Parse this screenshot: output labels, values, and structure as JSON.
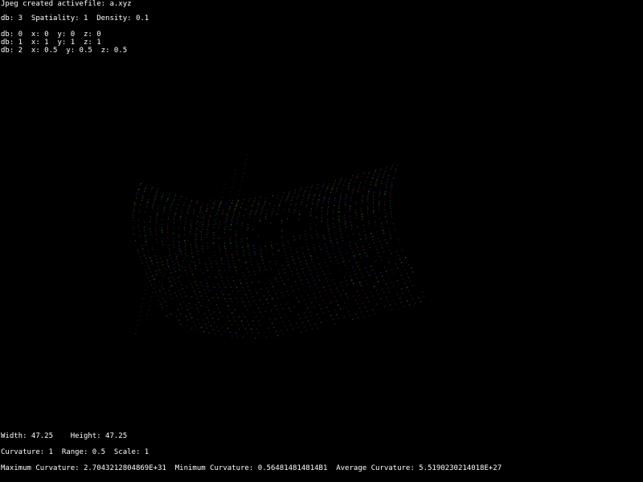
{
  "status": {
    "text": "Jpeg created activefile: a.xyz"
  },
  "db_summary": {
    "text": "db: 3  Spatiality: 1  Density: 0.1"
  },
  "databases": [
    {
      "text": "db: 0  x: 0  y: 0  z: 0"
    },
    {
      "text": "db: 1  x: 1  y: 1  z: 1"
    },
    {
      "text": "db: 2  x: 0.5  y: 0.5  z: 0.5"
    }
  ],
  "dimensions": {
    "text": "Width: 47.25    Height: 47.25"
  },
  "params": {
    "text": "Curvature: 1  Range: 0.5  Scale: 1"
  },
  "curvature": {
    "text": "Maximum Curvature: 2.7043212804869E+31  Minimum Curvature: 0.564814814814B1  Average Curvature: 5.5190230214018E+27"
  },
  "colors": {
    "background": "#000000",
    "text": "#ffffff",
    "point_green": "#2f9a2f",
    "point_red": "#a02a2a",
    "point_blue": "#3a3ab0"
  }
}
